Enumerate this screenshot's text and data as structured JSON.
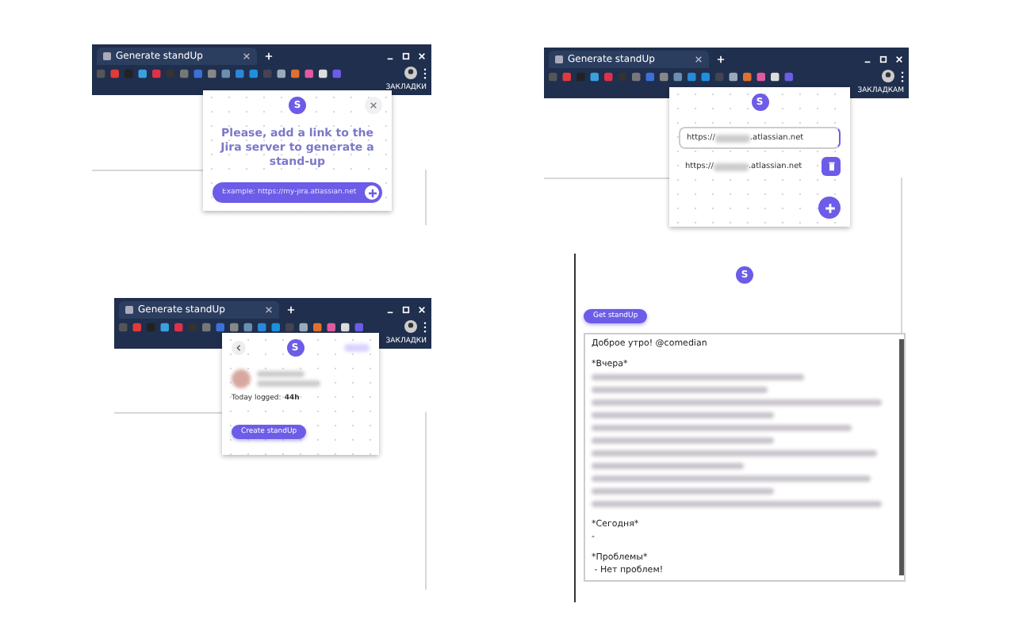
{
  "screens": [
    {
      "kind": "setup",
      "tab": "Generate standUp",
      "bookmarks": "ЗАКЛАДКИ",
      "logo": "S",
      "message": "Please, add a link to the Jira server to generate a stand-up",
      "placeholder": "Example: https://my-jira.atlassian.net"
    },
    {
      "kind": "servers",
      "tab": "Generate standUp",
      "bookmarks": "ЗАКЛАДКАМ",
      "logo": "S",
      "servers": [
        {
          "prefix": "https://",
          "suffix": ".atlassian.net",
          "selected": true
        },
        {
          "prefix": "https://",
          "suffix": ".atlassian.net",
          "selected": false
        }
      ]
    },
    {
      "kind": "user",
      "tab": "Generate standUp",
      "bookmarks": "ЗАКЛАДКИ",
      "logo": "S",
      "logged_label": "Today logged:",
      "logged_value": "44h",
      "button": "Create standUp"
    },
    {
      "kind": "standup",
      "logo": "S",
      "button": "Get standUp",
      "report": [
        {
          "kind": "text",
          "text": "Доброе утро! @comedian"
        },
        {
          "kind": "gap"
        },
        {
          "kind": "text",
          "text": "*Вчера*"
        },
        {
          "kind": "blurred"
        },
        {
          "kind": "blurred"
        },
        {
          "kind": "blurred"
        },
        {
          "kind": "blurred"
        },
        {
          "kind": "blurred"
        },
        {
          "kind": "blurred"
        },
        {
          "kind": "blurred"
        },
        {
          "kind": "blurred"
        },
        {
          "kind": "blurred"
        },
        {
          "kind": "blurred"
        },
        {
          "kind": "blurred"
        },
        {
          "kind": "gap"
        },
        {
          "kind": "text",
          "text": "*Сегодня*"
        },
        {
          "kind": "text",
          "text": "-"
        },
        {
          "kind": "gap"
        },
        {
          "kind": "text",
          "text": "*Проблемы*"
        },
        {
          "kind": "text",
          "text": " - Нет проблем!"
        }
      ]
    }
  ]
}
